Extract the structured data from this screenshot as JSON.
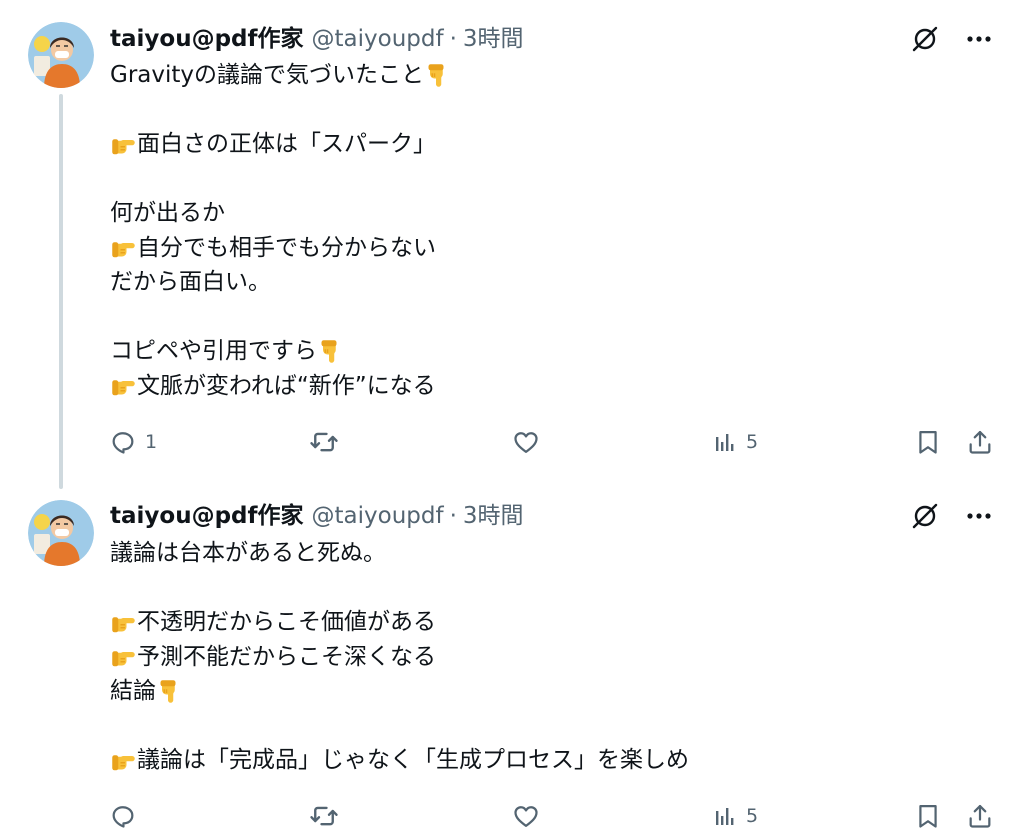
{
  "posts": [
    {
      "author": {
        "display_name": "taiyou@pdf作家",
        "handle": "@taiyoupdf",
        "separator": "·",
        "time": "3時間"
      },
      "lines": [
        {
          "emoji": null,
          "text": "Gravityの議論で気づいたこと",
          "trailing_emoji": "point-down"
        },
        {
          "emoji": null,
          "text": "",
          "trailing_emoji": null
        },
        {
          "emoji": "point-right",
          "text": "面白さの正体は「スパーク」",
          "trailing_emoji": null
        },
        {
          "emoji": null,
          "text": "",
          "trailing_emoji": null
        },
        {
          "emoji": null,
          "text": "何が出るか",
          "trailing_emoji": null
        },
        {
          "emoji": "point-right",
          "text": "自分でも相手でも分からない",
          "trailing_emoji": null
        },
        {
          "emoji": null,
          "text": "だから面白い。",
          "trailing_emoji": null
        },
        {
          "emoji": null,
          "text": "",
          "trailing_emoji": null
        },
        {
          "emoji": null,
          "text": "コピペや引用ですら",
          "trailing_emoji": "point-down"
        },
        {
          "emoji": "point-right",
          "text": "文脈が変われば“新作”になる",
          "trailing_emoji": null
        }
      ],
      "actions": {
        "reply_count": "1",
        "repost_count": "",
        "like_count": "",
        "views_count": "5"
      }
    },
    {
      "author": {
        "display_name": "taiyou@pdf作家",
        "handle": "@taiyoupdf",
        "separator": "·",
        "time": "3時間"
      },
      "lines": [
        {
          "emoji": null,
          "text": "議論は台本があると死ぬ。",
          "trailing_emoji": null
        },
        {
          "emoji": null,
          "text": "",
          "trailing_emoji": null
        },
        {
          "emoji": "point-right",
          "text": "不透明だからこそ価値がある",
          "trailing_emoji": null
        },
        {
          "emoji": "point-right",
          "text": "予測不能だからこそ深くなる",
          "trailing_emoji": null
        },
        {
          "emoji": null,
          "text": "結論",
          "trailing_emoji": "point-down"
        },
        {
          "emoji": null,
          "text": "",
          "trailing_emoji": null
        },
        {
          "emoji": "point-right",
          "text": "議論は「完成品」じゃなく「生成プロセス」を楽しめ",
          "trailing_emoji": null
        }
      ],
      "actions": {
        "reply_count": "",
        "repost_count": "",
        "like_count": "",
        "views_count": "5"
      }
    }
  ],
  "icons": {
    "grok": "grok-slash-icon",
    "more": "more-icon",
    "reply": "reply-icon",
    "repost": "repost-icon",
    "like": "like-icon",
    "views": "views-icon",
    "bookmark": "bookmark-icon",
    "share": "share-icon"
  },
  "colors": {
    "text": "#0f1419",
    "muted": "#536471",
    "thread_line": "#cfd9de",
    "emoji_yellow": "#f8c13a"
  }
}
